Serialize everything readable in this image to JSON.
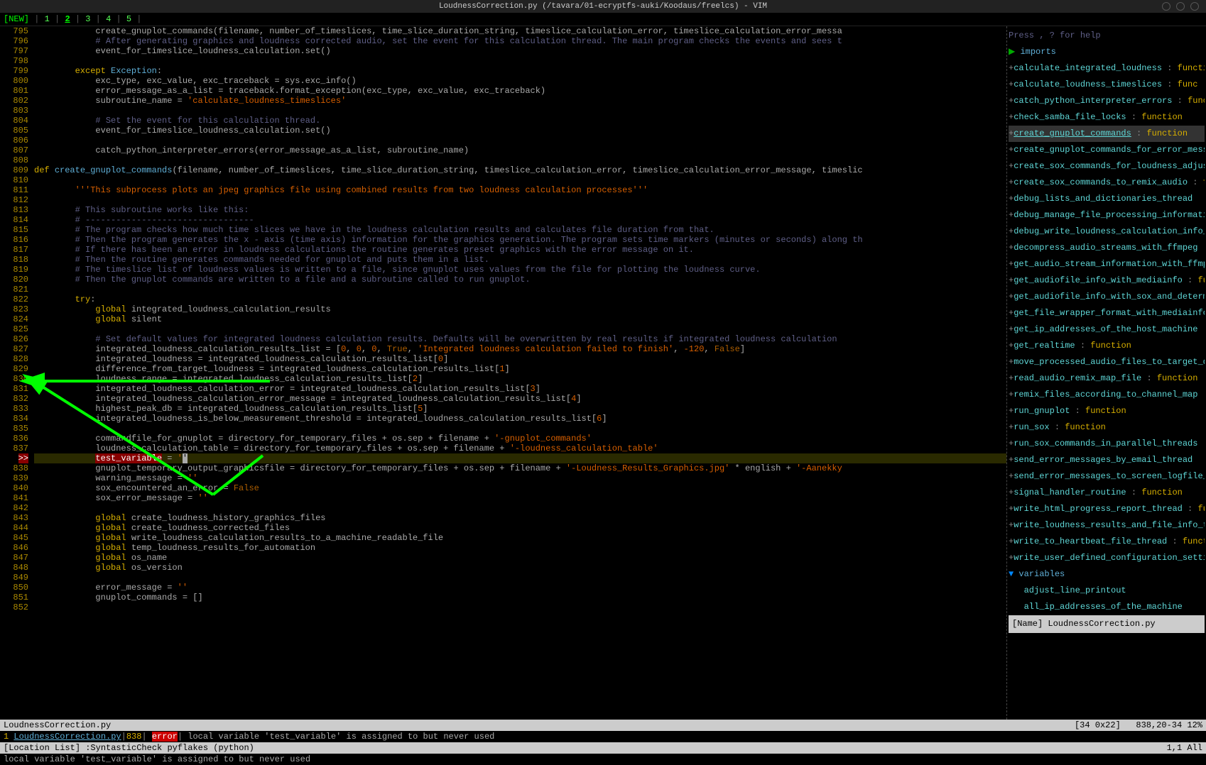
{
  "titlebar": "LoudnessCorrection.py (/tavara/01-ecryptfs-auki/Koodaus/freelcs) - VIM",
  "tabs": {
    "label": "[NEW]",
    "items": [
      "1",
      "2",
      "3",
      "4",
      "5"
    ],
    "active": 1
  },
  "gutter": {
    "error_marker": ">>",
    "lines": [
      795,
      796,
      797,
      798,
      799,
      800,
      801,
      802,
      803,
      804,
      805,
      806,
      807,
      808,
      809,
      810,
      811,
      812,
      813,
      814,
      815,
      816,
      817,
      818,
      819,
      820,
      821,
      822,
      823,
      824,
      825,
      826,
      827,
      828,
      829,
      830,
      831,
      832,
      833,
      834,
      835,
      836,
      837,
      838,
      839,
      840,
      841,
      842,
      843,
      844,
      845,
      846,
      847,
      848,
      849,
      850,
      851,
      852
    ]
  },
  "code": {
    "l795": "            create_gnuplot_commands(filename, number_of_timeslices, time_slice_duration_string, timeslice_calculation_error, timeslice_calculation_error_messa",
    "l796": "            # After generating graphics and loudness corrected audio, set the event for this calculation thread. The main program checks the events and sees t",
    "l797": "            event_for_timeslice_loudness_calculation.set()",
    "l798": "",
    "l799": "        except Exception:",
    "l800": "            exc_type, exc_value, exc_traceback = sys.exc_info()",
    "l801": "            error_message_as_a_list = traceback.format_exception(exc_type, exc_value, exc_traceback)",
    "l802_a": "            subroutine_name = ",
    "l802_b": "'calculate_loudness_timeslices'",
    "l803": "",
    "l804": "            # Set the event for this calculation thread.",
    "l805": "            event_for_timeslice_loudness_calculation.set()",
    "l806": "",
    "l807": "            catch_python_interpreter_errors(error_message_as_a_list, subroutine_name)",
    "l808": "",
    "l809_a": "def ",
    "l809_b": "create_gnuplot_commands",
    "l809_c": "(filename, number_of_timeslices, time_slice_duration_string, timeslice_calculation_error, timeslice_calculation_error_message, timeslic",
    "l810": "",
    "l811": "        '''This subprocess plots an jpeg graphics file using combined results from two loudness calculation processes'''",
    "l812": "",
    "l813": "        # This subroutine works like this:",
    "l814": "        # ---------------------------------",
    "l815": "        # The program checks how much time slices we have in the loudness calculation results and calculates file duration from that.",
    "l816": "        # Then the program generates the x - axis (time axis) information for the graphics generation. The program sets time markers (minutes or seconds) along th",
    "l817": "        # If there has been an error in loudness calculations the routine generates preset graphics with the error message on it.",
    "l818": "        # Then the routine generates commands needed for gnuplot and puts them in a list.",
    "l819": "        # The timeslice list of loudness values is written to a file, since gnuplot uses values from the file for plotting the loudness curve.",
    "l820": "        # Then the gnuplot commands are written to a file and a subroutine called to run gnuplot.",
    "l821": "",
    "l822": "        try:",
    "l823": "            global integrated_loudness_calculation_results",
    "l824": "            global silent",
    "l825": "",
    "l826": "            # Set default values for integrated loudness calculation results. Defaults will be overwritten by real results if integrated loudness calculation ",
    "l827_a": "            integrated_loudness_calculation_results_list = [",
    "l827_b": "0, 0, 0, True, 'Integrated loudness calculation failed to finish', -120, False",
    "l827_c": "]",
    "l828": "            integrated_loudness = integrated_loudness_calculation_results_list[0]",
    "l829": "            difference_from_target_loudness = integrated_loudness_calculation_results_list[1]",
    "l830": "            loudness_range = integrated_loudness_calculation_results_list[2]",
    "l831": "            integrated_loudness_calculation_error = integrated_loudness_calculation_results_list[3]",
    "l832": "            integrated_loudness_calculation_error_message = integrated_loudness_calculation_results_list[4]",
    "l833": "            highest_peak_db = integrated_loudness_calculation_results_list[5]",
    "l834": "            integrated_loudness_is_below_measurement_threshold = integrated_loudness_calculation_results_list[6]",
    "l835": "",
    "l836_a": "            commandfile_for_gnuplot = directory_for_temporary_files + os.sep + filename + ",
    "l836_b": "'-gnuplot_commands'",
    "l837_a": "            loudness_calculation_table = directory_for_temporary_files + os.sep + filename + ",
    "l837_b": "'-loudness_calculation_table'",
    "l838_a": "            ",
    "l838_b": "test_variable",
    "l838_c": " = ",
    "l838_d": "'",
    "l838_e": "'",
    "l839_a": "            gnuplot_temporary_output_graphicsfile = directory_for_temporary_files + os.sep + filename + ",
    "l839_b": "'-Loudness_Results_Graphics.jpg'",
    "l839_c": " * english + ",
    "l839_d": "'-Aanekky",
    "l840": "            warning_message = ''",
    "l841_a": "            sox_encountered_an_error = ",
    "l841_b": "False",
    "l842": "            sox_error_message = ''",
    "l843": "",
    "l844": "            global create_loudness_history_graphics_files",
    "l845": "            global create_loudness_corrected_files",
    "l846": "            global write_loudness_calculation_results_to_a_machine_readable_file",
    "l847": "            global temp_loudness_results_for_automation",
    "l848": "            global os_name",
    "l849": "            global os_version",
    "l850": "",
    "l851": "            error_message = ''",
    "l852": "            gnuplot_commands = []"
  },
  "statusbar1": {
    "left": "LoudnessCorrection.py",
    "mid": "[34 0x22]",
    "right": "838,20-34 12%"
  },
  "loclist": {
    "num": "1",
    "file": "LoudnessCorrection.py",
    "line": "838",
    "tag": "error",
    "msg": " local variable 'test_variable' is assigned to but never used"
  },
  "statusbar2": {
    "left": "[Location List] :SyntasticCheck pyflakes (python)",
    "right": "1,1           All"
  },
  "cmdline": "local variable 'test_variable' is assigned to but never used",
  "taglist": {
    "help": "Press <F1>, ? for help",
    "section_imports": "imports",
    "items": [
      {
        "name": "calculate_integrated_loudness",
        "type": "functi"
      },
      {
        "name": "calculate_loudness_timeslices",
        "type": "func"
      },
      {
        "name": "catch_python_interpreter_errors",
        "type": "func"
      },
      {
        "name": "check_samba_file_locks",
        "type": "function"
      },
      {
        "name": "create_gnuplot_commands",
        "type": "function",
        "selected": true
      },
      {
        "name": "create_gnuplot_commands_for_error_mess",
        "type": ""
      },
      {
        "name": "create_sox_commands_for_loudness_adjus",
        "type": ""
      },
      {
        "name": "create_sox_commands_to_remix_audio",
        "type": "f"
      },
      {
        "name": "debug_lists_and_dictionaries_thread",
        "type": ""
      },
      {
        "name": "debug_manage_file_processing_informati",
        "type": ""
      },
      {
        "name": "debug_write_loudness_calculation_info_",
        "type": ""
      },
      {
        "name": "decompress_audio_streams_with_ffmpeg",
        "type": ""
      },
      {
        "name": "get_audio_stream_information_with_ffmp",
        "type": ""
      },
      {
        "name": "get_audiofile_info_with_mediainfo",
        "type": "fu"
      },
      {
        "name": "get_audiofile_info_with_sox_and_determ",
        "type": ""
      },
      {
        "name": "get_file_wrapper_format_with_mediainfo",
        "type": ""
      },
      {
        "name": "get_ip_addresses_of_the_host_machine",
        "type": ""
      },
      {
        "name": "get_realtime",
        "type": "function"
      },
      {
        "name": "move_processed_audio_files_to_target_d",
        "type": ""
      },
      {
        "name": "read_audio_remix_map_file",
        "type": "function"
      },
      {
        "name": "remix_files_according_to_channel_map",
        "type": ""
      },
      {
        "name": "run_gnuplot",
        "type": "function"
      },
      {
        "name": "run_sox",
        "type": "function"
      },
      {
        "name": "run_sox_commands_in_parallel_threads",
        "type": ""
      },
      {
        "name": "send_error_messages_by_email_thread",
        "type": ""
      },
      {
        "name": "send_error_messages_to_screen_logfile_",
        "type": ""
      },
      {
        "name": "signal_handler_routine",
        "type": "function"
      },
      {
        "name": "write_html_progress_report_thread",
        "type": "fu"
      },
      {
        "name": "write_loudness_results_and_file_info_t",
        "type": ""
      },
      {
        "name": "write_to_heartbeat_file_thread",
        "type": "funct"
      },
      {
        "name": "write_user_defined_configuration_setti",
        "type": ""
      }
    ],
    "section_vars": "variables",
    "vars": [
      "adjust_line_printout",
      "all_ip_addresses_of_the_machine"
    ],
    "status": "[Name] LoudnessCorrection.py"
  }
}
